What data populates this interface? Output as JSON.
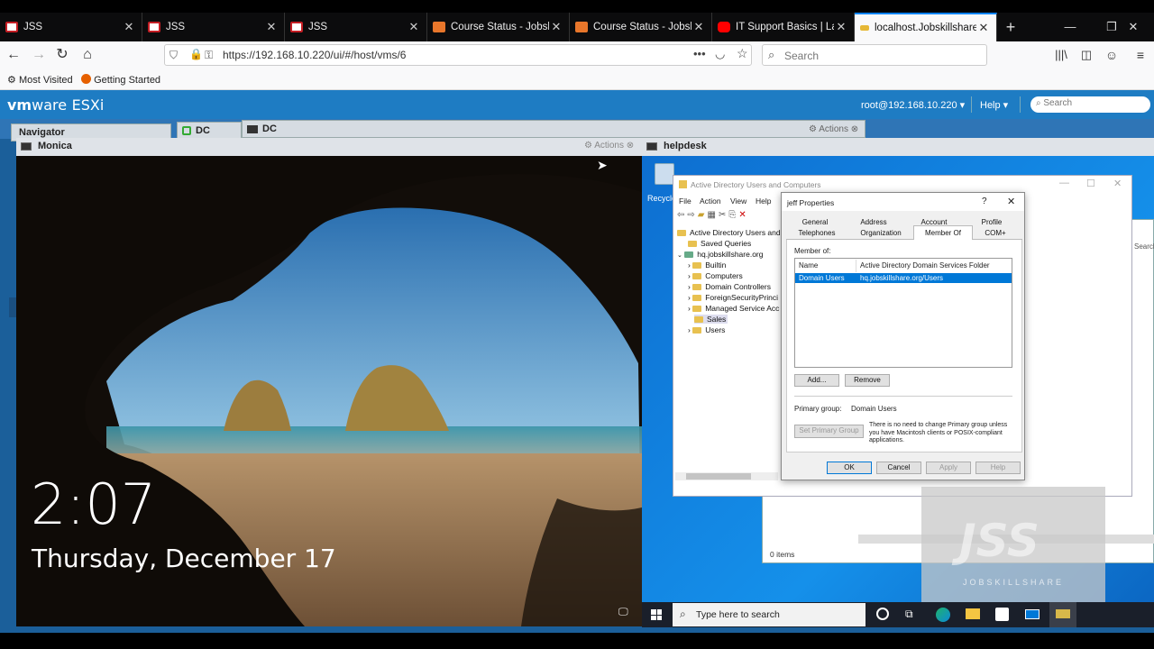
{
  "browser": {
    "tabs": [
      {
        "title": "JSS",
        "color": "#c41e24"
      },
      {
        "title": "JSS",
        "color": "#c41e24"
      },
      {
        "title": "JSS",
        "color": "#c41e24"
      },
      {
        "title": "Course Status - Jobskills",
        "color": "#e8762b"
      },
      {
        "title": "Course Status - Jobskills",
        "color": "#e8762b"
      },
      {
        "title": "IT Support Basics | Lab C",
        "color": "#ff0000"
      },
      {
        "title": "localhost.Jobskillshare.la",
        "color": "#e6b836"
      }
    ],
    "url": "https://192.168.10.220/ui/#/host/vms/6",
    "search_placeholder": "Search",
    "bookmarks": [
      "Most Visited",
      "Getting Started"
    ]
  },
  "esxi": {
    "logo_vm": "vm",
    "logo_ware": "ware",
    "logo_product": "ESXi",
    "user": "root@192.168.10.220",
    "help": "Help",
    "search_placeholder": "Search",
    "tabs": [
      "Navigator",
      "DC",
      "DC"
    ],
    "actions": "Actions"
  },
  "monica": {
    "title": "Monica",
    "actions": "Actions",
    "time": "2:07",
    "date": "Thursday, December 17"
  },
  "helpdesk": {
    "title": "helpdesk",
    "recycle": "Recycle",
    "aduc": {
      "title": "Active Directory Users and Computers",
      "menu": [
        "File",
        "Action",
        "View",
        "Help"
      ],
      "tree_root": "Active Directory Users and C",
      "tree": [
        {
          "label": "Saved Queries",
          "indent": 1
        },
        {
          "label": "hq.jobskillshare.org",
          "indent": 1
        },
        {
          "label": "Builtin",
          "indent": 2
        },
        {
          "label": "Computers",
          "indent": 2
        },
        {
          "label": "Domain Controllers",
          "indent": 2
        },
        {
          "label": "ForeignSecurityPrinci",
          "indent": 2
        },
        {
          "label": "Managed Service Acc",
          "indent": 2
        },
        {
          "label": "Sales",
          "indent": 2
        },
        {
          "label": "Users",
          "indent": 2
        }
      ],
      "items_count": "0 items",
      "search_hint": "Search"
    },
    "dialog": {
      "title": "jeff Properties",
      "help_glyph": "?",
      "tabs_row1": [
        "General",
        "Address",
        "Account",
        "Profile"
      ],
      "tabs_row2": [
        "Telephones",
        "Organization",
        "Member Of",
        "COM+"
      ],
      "member_of_label": "Member of:",
      "col_name": "Name",
      "col_folder": "Active Directory Domain Services Folder",
      "row_name": "Domain Users",
      "row_folder": "hq.jobskillshare.org/Users",
      "add": "Add...",
      "remove": "Remove",
      "primary_group_label": "Primary group:",
      "primary_group_value": "Domain Users",
      "set_primary": "Set Primary Group",
      "note": "There is no need to change Primary group unless you have Macintosh clients or POSIX-compliant applications.",
      "ok": "OK",
      "cancel": "Cancel",
      "apply": "Apply",
      "help": "Help"
    },
    "taskbar_search": "Type here to search",
    "watermark": "JSS",
    "watermark_sub": "JOBSKILLSHARE"
  }
}
